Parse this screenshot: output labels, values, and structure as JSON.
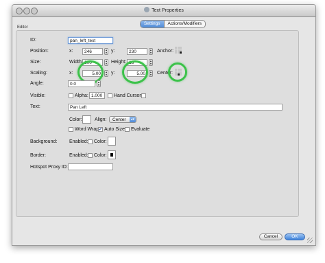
{
  "window": {
    "title": "Text Properties"
  },
  "tabs": [
    {
      "label": "Settings",
      "selected": true
    },
    {
      "label": "Actions/Modifiers",
      "selected": false
    }
  ],
  "group": {
    "label": "Editor"
  },
  "form": {
    "id": {
      "label": "ID:",
      "value": "pan_left_text"
    },
    "position": {
      "label": "Position:",
      "x_label": "x:",
      "x": "246",
      "y_label": "y:",
      "y": "230",
      "anchor_label": "Anchor:"
    },
    "size": {
      "label": "Size:",
      "width_label": "Width:",
      "width": "100",
      "height_label": "Height:",
      "height": "18"
    },
    "scaling": {
      "label": "Scaling:",
      "x_label": "x:",
      "x": "5.00",
      "y_label": "y:",
      "y": "5.00",
      "center_label": "Center:"
    },
    "angle": {
      "label": "Angle:",
      "value": "0.0"
    },
    "visible": {
      "label": "Visible:",
      "alpha_label": "Alpha:",
      "alpha": "1.000",
      "alpha_checked": false,
      "hand_cursor_label": "Hand Cursor:",
      "hand_cursor_checked": false
    },
    "text": {
      "label": "Text:",
      "value": "Pan Left"
    },
    "color": {
      "label": "Color:",
      "swatch": "#ffffff",
      "align_label": "Align:",
      "align_value": "Center"
    },
    "wrap": {
      "word_wrap_label": "Word Wrap",
      "word_wrap_checked": false,
      "auto_size_label": "Auto Size",
      "auto_size_checked": true,
      "evaluate_label": "Evaluate",
      "evaluate_checked": false
    },
    "background": {
      "label": "Background:",
      "enabled_label": "Enabled:",
      "enabled_checked": false,
      "color_label": "Color:",
      "swatch": "#ffffff"
    },
    "border": {
      "label": "Border:",
      "enabled_label": "Enabled:",
      "enabled_checked": false,
      "color_label": "Color:",
      "swatch": "#000000"
    },
    "hotspot": {
      "label": "Hotspot Proxy ID:",
      "value": ""
    }
  },
  "buttons": {
    "cancel": "Cancel",
    "ok": "OK"
  },
  "icons": {
    "check": "✔",
    "stepper_up": "▲",
    "stepper_down": "▼",
    "select_arrows": "▴▾"
  },
  "colors": {
    "highlight_ring": "#3cc24a",
    "accent": "#4f8bd8"
  }
}
